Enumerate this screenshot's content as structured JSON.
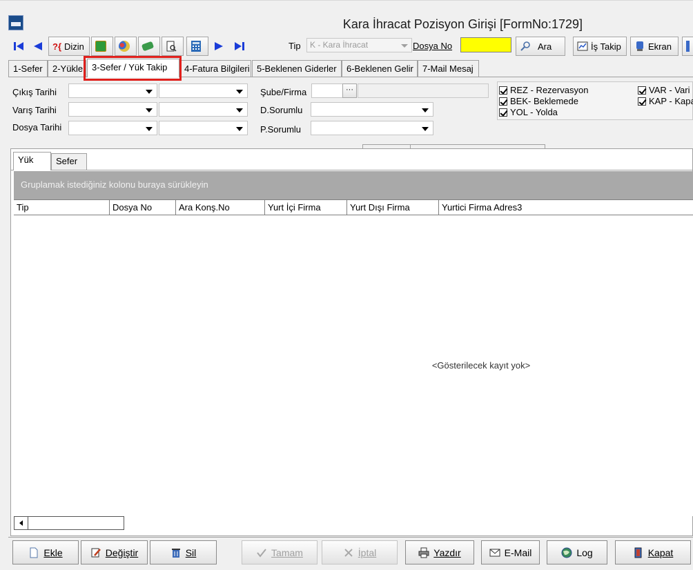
{
  "window": {
    "title": "Kara İhracat Pozisyon Girişi [FormNo:1729]"
  },
  "toolbar": {
    "dizin_label": "Dizin",
    "dizin_prefix": "?{",
    "tip_label": "Tip",
    "tip_value": "K - Kara  İhracat",
    "dosyano_label": "Dosya No",
    "ara_label": "Ara",
    "is_takip_label": "İş Takip",
    "ekran_label": "Ekran"
  },
  "tabs": [
    {
      "label": "1-Sefer"
    },
    {
      "label": "2-Yükle"
    },
    {
      "label": "3-Sefer / Yük Takip"
    },
    {
      "label": "4-Fatura Bilgileri"
    },
    {
      "label": "5-Beklenen Giderler"
    },
    {
      "label": "6-Beklenen Gelir"
    },
    {
      "label": "7-Mail Mesaj"
    }
  ],
  "filters": {
    "cikis_tarihi": "Çıkış Tarihi",
    "varis_tarihi": "Varış Tarihi",
    "dosya_tarihi": "Dosya Tarihi",
    "sube_firma": "Şube/Firma",
    "d_sorumlu": "D.Sorumlu",
    "p_sorumlu": "P.Sorumlu",
    "ellipsis": "···"
  },
  "statuses": [
    {
      "label": "REZ - Rezervasyon",
      "checked": true
    },
    {
      "label": "BEK- Beklemede",
      "checked": true
    },
    {
      "label": "YOL - Yolda",
      "checked": true
    },
    {
      "label": "VAR - Vari",
      "checked": true
    },
    {
      "label": "KAP - Kapa",
      "checked": true
    }
  ],
  "inner_tabs": [
    {
      "label": "Yük"
    },
    {
      "label": "Sefer"
    }
  ],
  "grid": {
    "group_hint": "Gruplamak istediğiniz kolonu buraya sürükleyin",
    "columns": [
      "Tip",
      "Dosya No",
      "Ara Konş.No",
      "Yurt İçi Firma",
      "Yurt Dışı Firma",
      "Yurtici Firma Adres3"
    ],
    "empty_message": "<Gösterilecek kayıt yok>"
  },
  "bottom_buttons": {
    "ekle": "Ekle",
    "degistir": "Değiştir",
    "sil": "Sil",
    "tamam": "Tamam",
    "iptal": "İptal",
    "yazdir": "Yazdır",
    "email": "E-Mail",
    "log": "Log",
    "kapat": "Kapat"
  }
}
